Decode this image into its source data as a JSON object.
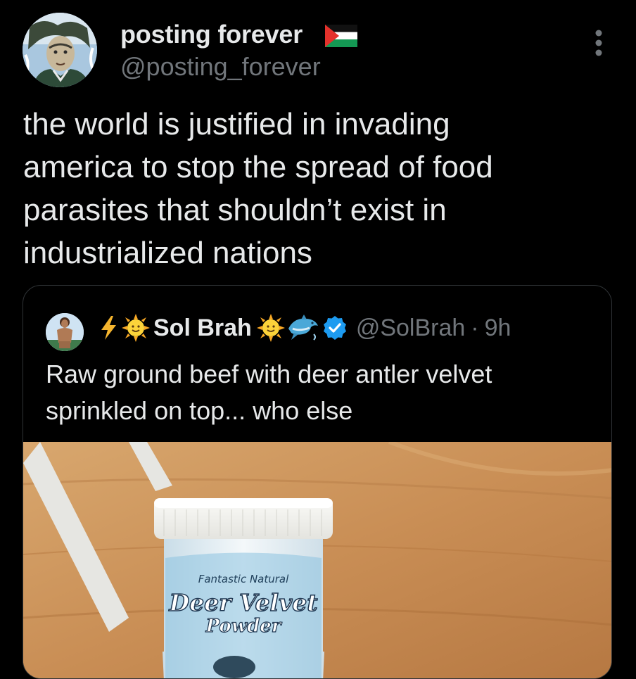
{
  "tweet": {
    "author": {
      "display_name": "posting forever",
      "handle": "@posting_forever",
      "flag_icon": "palestine-flag-icon"
    },
    "text": "the world is justified in invading\namerica to stop the spread of food\nparasites that shouldn’t exist in\nindustrialized nations"
  },
  "quoted_tweet": {
    "author": {
      "display_name": "Sol Brah",
      "handle": "@SolBrah",
      "separator": "·",
      "time": "9h",
      "name_prefix_icons": [
        "lightning-icon",
        "sun-icon"
      ],
      "name_suffix_icons": [
        "sun-icon",
        "dolphin-icon",
        "verified-badge-icon"
      ]
    },
    "text": "Raw ground beef with deer antler velvet\nsprinkled on top... who else",
    "media": {
      "product_line1": "Fantastic Natural",
      "product_line2": "Deer Velvet",
      "product_line3": "Powder"
    }
  },
  "colors": {
    "background": "#000000",
    "text_primary": "#e7e9ea",
    "text_secondary": "#71767b",
    "border": "#2f3336",
    "verified_blue": "#1d9bf0"
  }
}
